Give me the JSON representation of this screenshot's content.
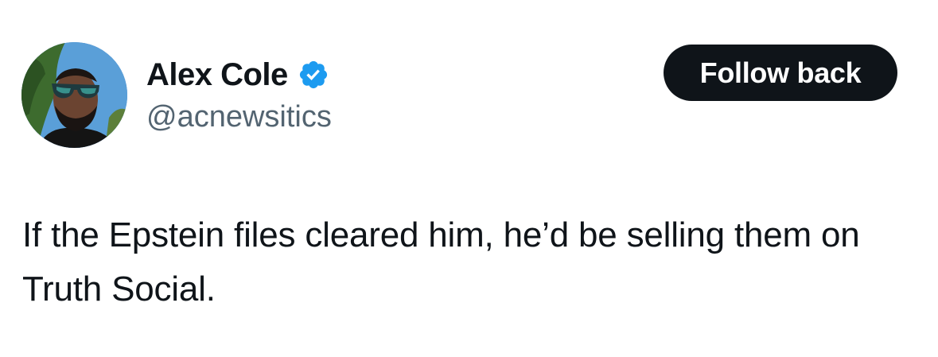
{
  "author": {
    "display_name": "Alex Cole",
    "handle": "@acnewsitics",
    "verified_icon": "verified-badge-icon",
    "verified_color": "#1d9bf0"
  },
  "actions": {
    "follow_label": "Follow back"
  },
  "tweet": {
    "text": "If the Epstein files cleared him, he’d be selling them on Truth Social."
  },
  "colors": {
    "text_primary": "#0f1419",
    "text_secondary": "#536471",
    "button_bg": "#0f1419",
    "button_text": "#ffffff"
  }
}
